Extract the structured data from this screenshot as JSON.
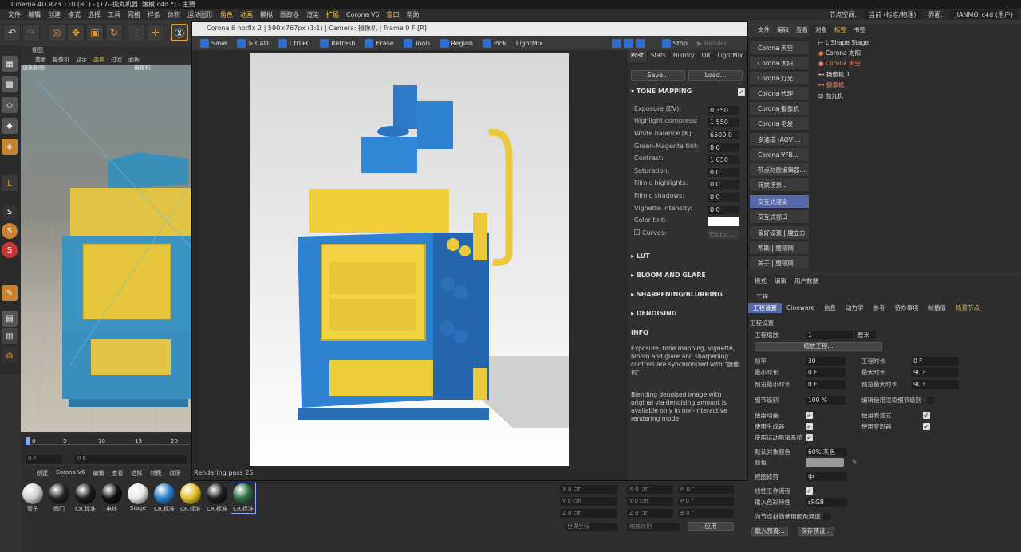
{
  "app": {
    "title": "Cinema 4D R23.110 (RC) - [17--抛丸机器1建模.c4d *] - 主要"
  },
  "menubar": [
    "文件",
    "编辑",
    "创建",
    "模式",
    "选择",
    "工具",
    "网格",
    "样条",
    "体积",
    "运动图形",
    "角色",
    "动画",
    "模拟",
    "跟踪器",
    "渲染",
    "扩展",
    "Corona V6",
    "窗口",
    "帮助"
  ],
  "menubar_right": {
    "space_label": "节点空间:",
    "space_value": "当前 (标准/物理)",
    "layout_label": "界面:",
    "layout_value": "JIANMO_c4d (用户)"
  },
  "viewport": {
    "header": "视图",
    "menu": [
      "查看",
      "摄像机",
      "显示",
      "选项",
      "过滤",
      "面板"
    ],
    "view_label": "透视视图",
    "camera_label": "摄像机"
  },
  "timeline": {
    "ticks": [
      "0",
      "5",
      "10",
      "15",
      "20"
    ],
    "frame_start": "0 F",
    "frame_current": "0 F"
  },
  "vfb": {
    "title": "Corona 6 hotfix 2 | 590×767px (1:1) | Camera: 摄像机 | Frame 0 F [R]",
    "toolbar": [
      "Save",
      "> C4D",
      "Ctrl+C",
      "Refresh",
      "Erase",
      "Tools",
      "Region",
      "Pick",
      "LightMix"
    ],
    "stop": "Stop",
    "render": "Render",
    "status": "Rendering pass 25",
    "tabs": [
      "Post",
      "Stats",
      "History",
      "DR",
      "LightMix"
    ],
    "save_btn": "Save...",
    "load_btn": "Load...",
    "tone_mapping": "TONE MAPPING",
    "params": [
      {
        "label": "Exposure (EV):",
        "value": "0.350"
      },
      {
        "label": "Highlight compress:",
        "value": "1.550"
      },
      {
        "label": "White balance [K]:",
        "value": "6500.0"
      },
      {
        "label": "Green-Magenta tint:",
        "value": "0.0"
      },
      {
        "label": "Contrast:",
        "value": "1.650"
      },
      {
        "label": "Saturation:",
        "value": "0.0"
      },
      {
        "label": "Filmic highlights:",
        "value": "0.0"
      },
      {
        "label": "Filmic shadows:",
        "value": "0.0"
      },
      {
        "label": "Vignette intensity:",
        "value": "0.0"
      }
    ],
    "color_tint": "Color tint:",
    "curves": "Curves:",
    "editor": "Editor...",
    "sections": [
      "LUT",
      "BLOOM AND GLARE",
      "SHARPENING/BLURRING",
      "DENOISING"
    ],
    "info_title": "INFO",
    "info1": "Exposure, tone mapping, vignette, bloom and glare and sharpening controls are synchronized with \"摄像机\".",
    "info2": "Blending denoised image with original via denoising amount is available only in non-interactive rendering mode"
  },
  "commands": [
    "Corona 天空",
    "Corona 太阳",
    "Corona 灯光",
    "Corona 代理",
    "Corona 摄像机",
    "Corona 毛发",
    "多通道 (AOV)...",
    "Corona VFB...",
    "节点材质编辑器...",
    "转换场景...",
    "交互式渲染",
    "交互式视口",
    "偏好设置 | 魔立方",
    "帮助 | 魔顿网",
    "关于 | 魔顿网"
  ],
  "objmgr": {
    "menu": [
      "文件",
      "编辑",
      "查看",
      "对象",
      "标签",
      "书签"
    ],
    "objects": [
      "L Shape Stage",
      "Corona 太阳",
      "Corona 天空",
      "摄像机.1",
      "摄像机",
      "抛丸机"
    ]
  },
  "attr": {
    "menu": [
      "模式",
      "编辑",
      "用户数据"
    ],
    "section": "工程",
    "tabs": [
      "工程设置",
      "Cineware",
      "信息",
      "动力学",
      "参考",
      "待办事项",
      "帧插值",
      "场景节点"
    ],
    "subtitle": "工程设置",
    "scale_label": "工程缩放",
    "scale_value": "1",
    "scale_unit": "厘米",
    "scale_btn": "缩放工程...",
    "fps_label": "帧率",
    "fps": "30",
    "projtime_label": "工程时长",
    "projtime": "0 F",
    "mintime_label": "最小时长",
    "mintime": "0 F",
    "maxtime_label": "最大时长",
    "maxtime": "90 F",
    "prevmin_label": "预览最小时长",
    "prevmin": "0 F",
    "prevmax_label": "预览最大时长",
    "prevmax": "90 F",
    "lod_label": "细节级别",
    "lod": "100 %",
    "lod_render": "编辑使用渲染细节级别",
    "use_anim": "使用动画",
    "use_expr": "使用表达式",
    "use_gen": "使用生成器",
    "use_deform": "使用变形器",
    "use_motion": "使用运动剪辑系统",
    "defcolor_label": "默认对象颜色",
    "defcolor": "60% 灰色",
    "color_label": "颜色",
    "clip_label": "视图修剪",
    "clip": "中",
    "linear_label": "线性工作流程",
    "colorprof_label": "输入色彩特性",
    "colorprof": "sRGB",
    "nodecolor": "为节点材质使用颜色通道",
    "load_preset": "载入预设...",
    "save_preset": "保存预设..."
  },
  "materials": {
    "menu": [
      "创建",
      "Corona V6",
      "编辑",
      "查看",
      "选择",
      "材质",
      "纹理"
    ],
    "items": [
      {
        "name": "管子",
        "color": "#d0d0d0"
      },
      {
        "name": "阀门",
        "color": "#222222"
      },
      {
        "name": "CR.标准",
        "color": "#1a1a1a"
      },
      {
        "name": "电线",
        "color": "#111111"
      },
      {
        "name": "Stage",
        "color": "#e8e8e8"
      },
      {
        "name": "CR.标准",
        "color": "#2a7fc8"
      },
      {
        "name": "CR.标准",
        "color": "#e2c02a"
      },
      {
        "name": "CR.标准",
        "color": "#1c1c1c"
      },
      {
        "name": "CR.标准",
        "color": "#2e6d45"
      }
    ]
  },
  "coords": {
    "apply": "应用",
    "world": "世界坐标",
    "scale": "缩放比例",
    "x": "X  0 cm",
    "y": "Y  0 cm",
    "z": "Z  0 cm",
    "h": "H  0 °",
    "p": "P  0 °",
    "b": "B  0 °"
  },
  "colors": {
    "accent": "#5568a7",
    "machine_blue": "#2f7fd0",
    "machine_yellow": "#f0cf3a"
  }
}
